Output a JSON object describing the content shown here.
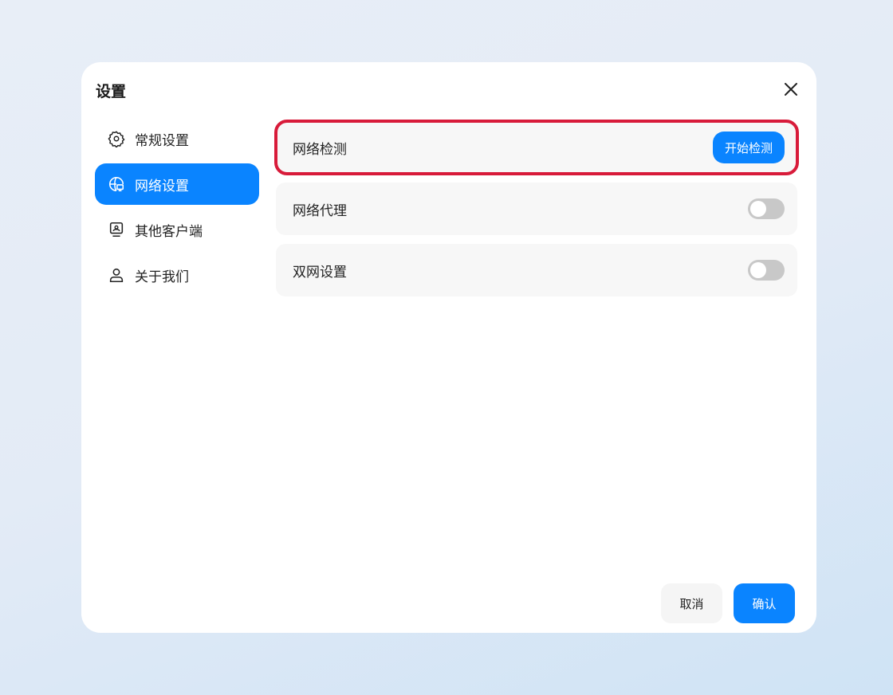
{
  "dialog": {
    "title": "设置"
  },
  "sidebar": {
    "items": [
      {
        "label": "常规设置",
        "icon": "gear-icon"
      },
      {
        "label": "网络设置",
        "icon": "globe-icon",
        "active": true
      },
      {
        "label": "其他客户端",
        "icon": "monitor-icon"
      },
      {
        "label": "关于我们",
        "icon": "user-icon"
      }
    ]
  },
  "rows": [
    {
      "label": "网络检测",
      "button": "开始检测"
    },
    {
      "label": "网络代理",
      "toggle": false
    },
    {
      "label": "双网设置",
      "toggle": false
    }
  ],
  "footer": {
    "cancel": "取消",
    "confirm": "确认"
  },
  "colors": {
    "accent": "#0a84ff",
    "highlight": "#d81b3a"
  }
}
